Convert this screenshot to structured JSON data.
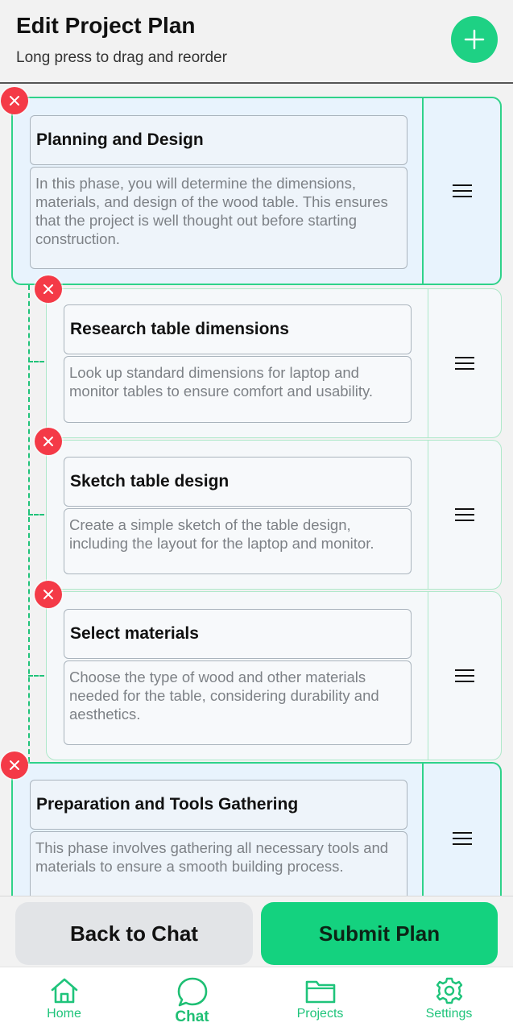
{
  "header": {
    "title": "Edit Project Plan",
    "subtitle": "Long press to drag and reorder",
    "add_icon": "plus-icon"
  },
  "plan": {
    "phases": [
      {
        "title": "Planning and Design",
        "description": "In this phase, you will determine the dimensions, materials, and design of the wood table. This ensures that the project is well thought out before starting construction.",
        "tasks": [
          {
            "title": "Research table dimensions",
            "description": "Look up standard dimensions for laptop and monitor tables to ensure comfort and usability."
          },
          {
            "title": "Sketch table design",
            "description": "Create a simple sketch of the table design, including the layout for the laptop and monitor."
          },
          {
            "title": "Select materials",
            "description": "Choose the type of wood and other materials needed for the table, considering durability and aesthetics."
          }
        ]
      },
      {
        "title": "Preparation and Tools Gathering",
        "description": "This phase involves gathering all necessary tools and materials to ensure a smooth building process.",
        "tasks": []
      }
    ]
  },
  "actions": {
    "back_label": "Back to Chat",
    "submit_label": "Submit Plan"
  },
  "nav": {
    "items": [
      {
        "label": "Home",
        "icon": "home-icon"
      },
      {
        "label": "Chat",
        "icon": "chat-icon",
        "active": true
      },
      {
        "label": "Projects",
        "icon": "folder-icon"
      },
      {
        "label": "Settings",
        "icon": "gear-icon"
      }
    ]
  },
  "colors": {
    "accent": "#1ed184",
    "delete": "#f43a47",
    "phase_bg": "#e8f3fd",
    "task_bg": "#f5f8fa"
  }
}
